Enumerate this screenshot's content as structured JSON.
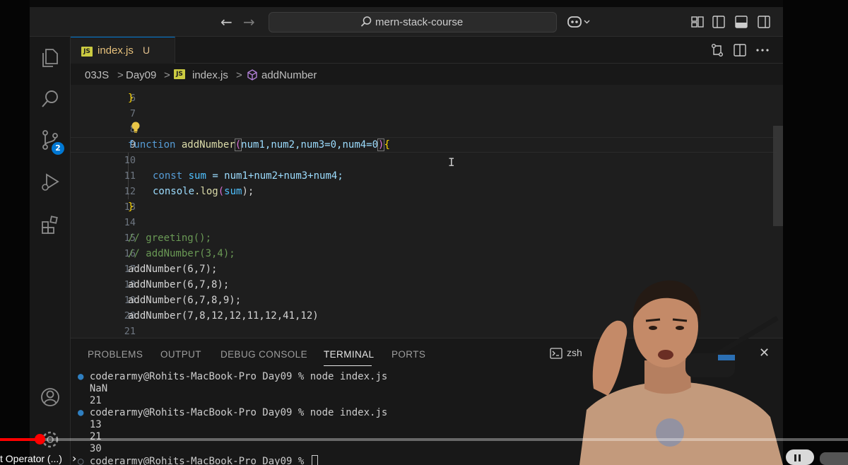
{
  "title_bar": {
    "back_arrow": "←",
    "forward_arrow": "→",
    "search_text": "mern-stack-course"
  },
  "activity_bar": {
    "source_control_badge": "2",
    "icons": [
      "explorer-icon",
      "search-icon",
      "source-control-icon",
      "run-debug-icon",
      "extensions-icon",
      "account-icon",
      "settings-gear-icon"
    ]
  },
  "tab": {
    "badge": "JS",
    "name": "index.js",
    "status": "U"
  },
  "breadcrumb": {
    "items": [
      "03JS",
      "Day09",
      "index.js",
      "addNumber"
    ],
    "separator": ">"
  },
  "editor": {
    "line_numbers": [
      "6",
      "7",
      "8",
      "9",
      "10",
      "11",
      "12",
      "13",
      "14",
      "15",
      "16",
      "17",
      "18",
      "19",
      "20",
      "21"
    ],
    "active_line": "9",
    "code": {
      "l6": "}",
      "l9_kw": "function",
      "l9_fn": "addNumber",
      "l9_open": "(",
      "l9_params": "num1,num2,num3=0,num4=0",
      "l9_close": ")",
      "l9_brace": "{",
      "l11_kw": "const",
      "l11_var": "sum",
      "l11_rest": " = num1+num2+num3+num4;",
      "l12_obj": "console",
      "l12_method": ".log",
      "l12_open": "(",
      "l12_arg": "sum",
      "l12_close": ");",
      "l13": "}",
      "l15": "// greeting();",
      "l16": "// addNumber(3,4);",
      "l17": "addNumber(6,7);",
      "l18": "addNumber(6,7,8);",
      "l19": "addNumber(6,7,8,9);",
      "l20": "addNumber(7,8,12,12,11,12,41,12)"
    }
  },
  "panel": {
    "tabs": [
      "PROBLEMS",
      "OUTPUT",
      "DEBUG CONSOLE",
      "TERMINAL",
      "PORTS"
    ],
    "active_tab": "TERMINAL",
    "shell": "zsh",
    "close": "✕",
    "terminal": {
      "prompt1": "coderarmy@Rohits-MacBook-Pro Day09 % node index.js",
      "out1": "NaN",
      "out2": "21",
      "prompt2": "coderarmy@Rohits-MacBook-Pro Day09 % node index.js",
      "out3": "13",
      "out4": "21",
      "out5": "30",
      "prompt3": "coderarmy@Rohits-MacBook-Pro Day09 % "
    }
  },
  "video_player": {
    "chapter_title": "t Operator (...)",
    "chapter_arrow": "›",
    "progress_fraction": 0.047
  },
  "colors": {
    "editor_bg": "#1e1e1e",
    "accent": "#0078d4",
    "progress": "#ff0000"
  }
}
